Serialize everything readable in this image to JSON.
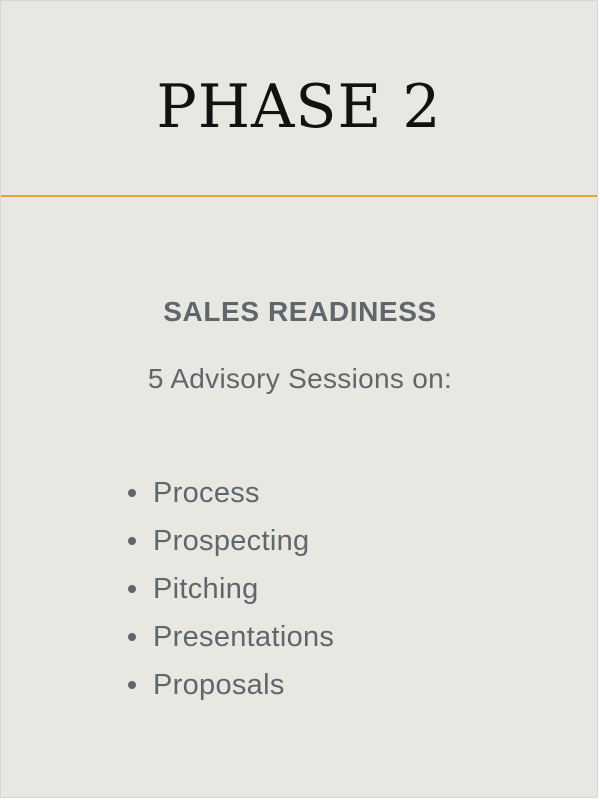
{
  "header": {
    "title": "PHASE 2"
  },
  "main": {
    "heading": "SALES READINESS",
    "subtitle": "5 Advisory Sessions on:",
    "topics": [
      "Process",
      "Prospecting",
      "Pitching",
      "Presentations",
      "Proposals"
    ]
  },
  "colors": {
    "background": "#e8e7e2",
    "divider": "#e3a03f",
    "text": "#5f666c",
    "title": "#111111"
  }
}
